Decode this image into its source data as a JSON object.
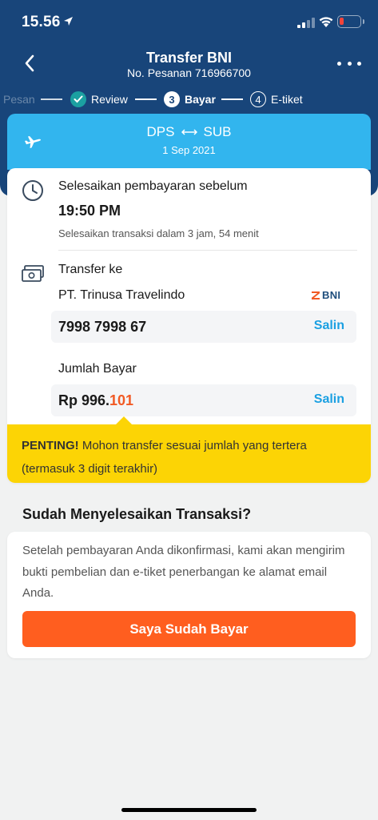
{
  "status_bar": {
    "time": "15.56"
  },
  "nav": {
    "title": "Transfer BNI",
    "subtitle": "No. Pesanan 716966700"
  },
  "steps": {
    "previous": "Pesan",
    "review": "Review",
    "bayar_num": "3",
    "bayar": "Bayar",
    "etiket_num": "4",
    "etiket": "E-tiket"
  },
  "flight": {
    "origin": "DPS",
    "destination": "SUB",
    "date": "1 Sep 2021"
  },
  "deadline": {
    "label": "Selesaikan pembayaran sebelum",
    "time": "19:50 PM",
    "note": "Selesaikan transaksi dalam 3 jam, 54 menit"
  },
  "transfer": {
    "label": "Transfer ke",
    "company": "PT. Trinusa Travelindo",
    "bank": "BNI",
    "account_number": "7998 7998 67",
    "copy_label": "Salin"
  },
  "amount": {
    "label": "Jumlah Bayar",
    "prefix": "Rp 996.",
    "suffix": "101",
    "copy_label": "Salin"
  },
  "warning": {
    "bold": "PENTING!",
    "text": " Mohon transfer sesuai jumlah yang tertera (termasuk 3 digit terakhir)"
  },
  "confirmation": {
    "title": "Sudah Menyelesaikan Transaksi?",
    "text": "Setelah pembayaran Anda dikonfirmasi, kami akan mengirim bukti pembelian dan e-tiket penerbangan ke alamat email Anda.",
    "button": "Saya Sudah Bayar"
  },
  "colors": {
    "header": "#18457a",
    "flight_card": "#32b5ee",
    "accent_link": "#1ba0e2",
    "orange": "#f15a24",
    "warning": "#fcd405",
    "pay_button": "#ff5e1f"
  },
  "icons": [
    "location-arrow-icon",
    "signal-icon",
    "wifi-icon",
    "battery-icon",
    "back-arrow-icon",
    "more-icon",
    "check-icon",
    "airplane-icon",
    "double-arrow-icon",
    "clock-icon",
    "money-icon",
    "bni-logo"
  ]
}
